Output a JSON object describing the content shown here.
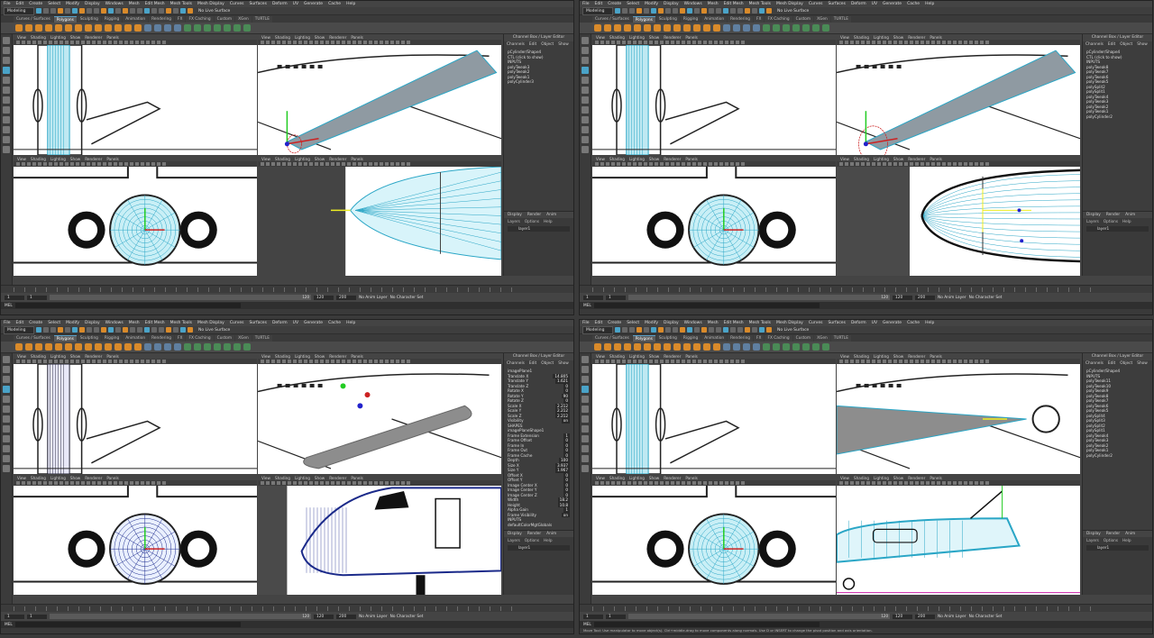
{
  "menu": [
    "File",
    "Edit",
    "Create",
    "Select",
    "Modify",
    "Display",
    "Windows",
    "Mesh",
    "Edit Mesh",
    "Mesh Tools",
    "Mesh Display",
    "Curves",
    "Surfaces",
    "Deform",
    "UV",
    "Generate",
    "Cache",
    "Help"
  ],
  "mode": "Modeling",
  "no_live": "No Live Surface",
  "shelf_tabs": [
    "Curves / Surfaces",
    "Polygons",
    "Sculpting",
    "Rigging",
    "Animation",
    "Rendering",
    "FX",
    "FX Caching",
    "Custom",
    "XGen",
    "TURTLE"
  ],
  "active_shelf_tab": "Polygons",
  "panel_menu": [
    "View",
    "Shading",
    "Lighting",
    "Show",
    "Renderer",
    "Panels"
  ],
  "channel_box_title": "Channel Box / Layer Editor",
  "channel_menu": [
    "Channels",
    "Edit",
    "Object",
    "Show"
  ],
  "layer_tabs": [
    "Display",
    "Render",
    "Anim"
  ],
  "layer_menu": [
    "Layers",
    "Options",
    "Help"
  ],
  "layer_name": "layer1",
  "time": {
    "current": "1",
    "start": "1",
    "range_end": "120",
    "end": "120",
    "end2": "200",
    "anim_layer": "No Anim Layer",
    "char_set": "No Character Set"
  },
  "mel": "MEL",
  "help_line": "Move Tool: Use manipulator to move object(s). Ctrl+middle-drag to move components along normals. Use D or INSERT to change the pivot position and axis orientation.",
  "panels": [
    {
      "id": "tl",
      "channel_list": [
        "pCylinder/Shape4",
        "CTL (click to show)",
        "INPUTS",
        "polyTweak3",
        "polyTweak2",
        "polyTweak1",
        "polyCylinder3"
      ]
    },
    {
      "id": "tr",
      "channel_list": [
        "pCylinder/Shape4",
        "CTL (click to show)",
        "INPUTS",
        "polyTweak8",
        "polyTweak7",
        "polyTweak6",
        "polyTweak5",
        "polySplit2",
        "polySplit1",
        "polyTweak4",
        "polyTweak3",
        "polyTweak2",
        "polyTweak1",
        "polyCylinder2"
      ]
    },
    {
      "id": "bl",
      "channel_title": "imagePlane1",
      "attrs": [
        [
          "Translate X",
          "14.805"
        ],
        [
          "Translate Y",
          "1.621"
        ],
        [
          "Translate Z",
          "0"
        ],
        [
          "Rotate X",
          "0"
        ],
        [
          "Rotate Y",
          "90"
        ],
        [
          "Rotate Z",
          "0"
        ],
        [
          "Scale X",
          "2.212"
        ],
        [
          "Scale Y",
          "2.212"
        ],
        [
          "Scale Z",
          "2.212"
        ],
        [
          "Visibility",
          "on"
        ]
      ],
      "shapes_title": "SHAPES",
      "shape_name": "imagePlaneShape1",
      "shape_attrs": [
        [
          "Frame Extension",
          "1"
        ],
        [
          "Frame Offset",
          "0"
        ],
        [
          "Frame In",
          "0"
        ],
        [
          "Frame Out",
          "0"
        ],
        [
          "Frame Cache",
          "0"
        ],
        [
          "Depth",
          "100"
        ],
        [
          "Size X",
          "3.937"
        ],
        [
          "Size Y",
          "1.967"
        ],
        [
          "Offset X",
          "0"
        ],
        [
          "Offset Y",
          "0"
        ],
        [
          "Image Center X",
          "0"
        ],
        [
          "Image Center Y",
          "0"
        ],
        [
          "Image Center Z",
          "0"
        ],
        [
          "Width",
          "18.2"
        ],
        [
          "Height",
          "10.8"
        ],
        [
          "Alpha Gain",
          "1"
        ],
        [
          "Frame Visibility",
          "on"
        ]
      ],
      "inputs_title": "INPUTS",
      "input_name": "defaultColorMgtGlobals"
    },
    {
      "id": "br",
      "channel_list": [
        "pCylinder/Shape4",
        "INPUTS",
        "polyTweak11",
        "polyTweak10",
        "polyTweak9",
        "polyTweak8",
        "polyTweak7",
        "polyTweak6",
        "polyTweak5",
        "polySplit4",
        "polySplit3",
        "polySplit2",
        "polySplit1",
        "polyTweak4",
        "polyTweak3",
        "polyTweak2",
        "polyTweak1",
        "polyCylinder2"
      ]
    }
  ]
}
